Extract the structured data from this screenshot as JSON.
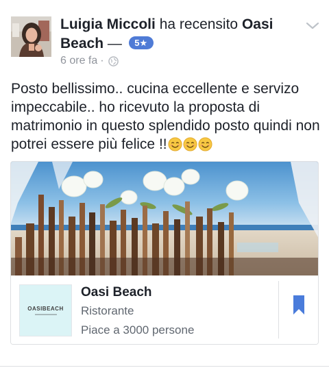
{
  "post": {
    "author": "Luigia Miccoli",
    "verb": "ha recensito",
    "place_line1": "Oasi",
    "place_line2": "Beach",
    "dash": "—",
    "rating": "5★",
    "time": "6 ore fa",
    "separator": "·",
    "privacy_icon": "globe-icon",
    "menu_icon": "chevron-down-icon",
    "text": "Posto bellissimo.. cucina eccellente e servizo impeccabile.. ho ricevuto la proposta di matrimonio in questo splendido posto quindi non potrei essere più felice !!",
    "emoji": [
      "😊",
      "😊",
      "😊"
    ]
  },
  "card": {
    "page_name": "Oasi Beach",
    "category": "Ristorante",
    "likes": "Piace a 3000 persone",
    "logo_text": "OASIBEACH",
    "bookmark_icon": "bookmark-icon"
  },
  "colors": {
    "rating_badge": "#4f7bd6",
    "bookmark": "#4a7cdb",
    "meta_text": "#90949c",
    "logo_bg": "#dbf4f6"
  }
}
